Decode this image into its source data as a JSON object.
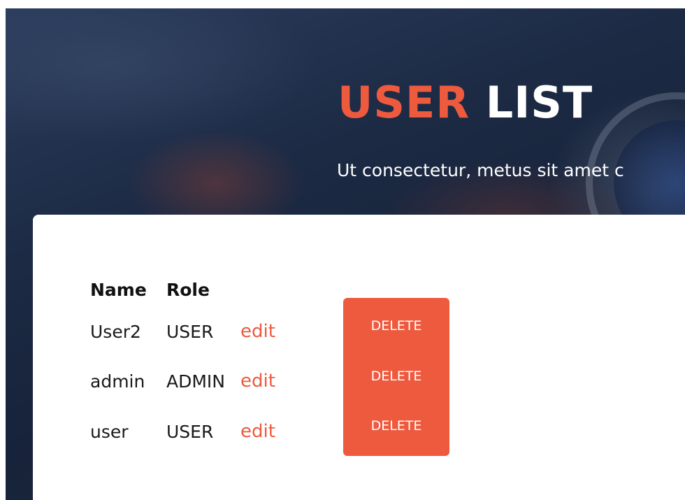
{
  "hero": {
    "title_accent": "USER",
    "title_rest": "LIST",
    "subtitle": "Ut consectetur, metus sit amet c"
  },
  "table": {
    "headers": [
      "Name",
      "Role"
    ],
    "rows": [
      {
        "name": "User2",
        "role": "USER",
        "edit_label": "edit",
        "delete_label": "DELETE"
      },
      {
        "name": "admin",
        "role": "ADMIN",
        "edit_label": "edit",
        "delete_label": "DELETE"
      },
      {
        "name": "user",
        "role": "USER",
        "edit_label": "edit",
        "delete_label": "DELETE"
      }
    ]
  },
  "colors": {
    "accent": "#ee5a3e",
    "hero_dark": "#1c2a44",
    "text": "#1a1a1a"
  }
}
